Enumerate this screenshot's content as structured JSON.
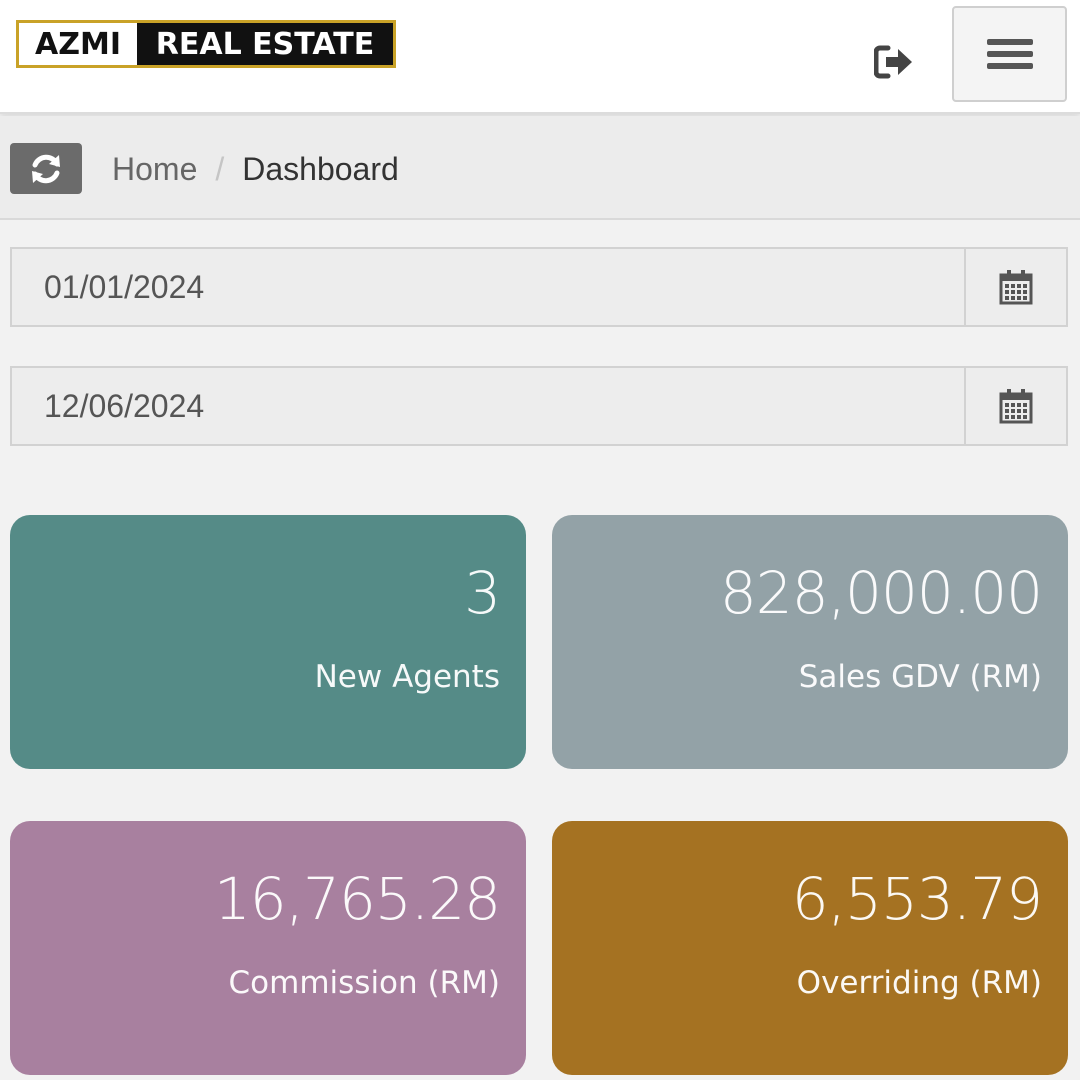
{
  "header": {
    "logo_left": "AZMI",
    "logo_right": "REAL ESTATE",
    "logout_icon": "sign-out-icon",
    "menu_icon": "hamburger-menu-icon"
  },
  "breadcrumb": {
    "refresh_icon": "refresh-icon",
    "items": [
      "Home",
      "Dashboard"
    ],
    "separator": "/"
  },
  "filters": {
    "start_date": "01/01/2024",
    "end_date": "12/06/2024",
    "calendar_icon": "calendar-icon"
  },
  "stats": [
    {
      "value": "3",
      "label": "New Agents",
      "color": "#558b87"
    },
    {
      "value": "828,000.00",
      "label": "Sales GDV (RM)",
      "color": "#93a2a7"
    },
    {
      "value": "16,765.28",
      "label": "Commission (RM)",
      "color": "#a8809f"
    },
    {
      "value": "6,553.79",
      "label": "Overriding (RM)",
      "color": "#a57222"
    }
  ],
  "colors": {
    "logo_border": "#c9a227",
    "background": "#f2f2f2"
  }
}
